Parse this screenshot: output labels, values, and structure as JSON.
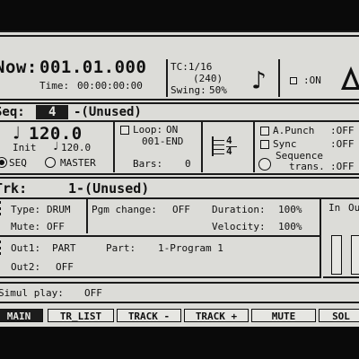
{
  "header": {
    "now_label": "Now:",
    "now_value": "001.01.000",
    "time_label": "Time:",
    "time_value": "00:00:00:00",
    "tc_value": "TC:1/16",
    "tc_paren": "(240)",
    "swing_label": "Swing:",
    "swing_value": "50%",
    "click_label": ":ON"
  },
  "seq": {
    "label": "Seq:",
    "number": "4",
    "name": "-(Unused)",
    "tempo": "120.0",
    "init_label": "Init",
    "init_tempo": "120.0",
    "source_seq": "SEQ",
    "source_master": "MASTER",
    "loop_label": "Loop:",
    "loop_value": "ON",
    "loop_end": "001-END",
    "bars_label": "Bars:",
    "bars_value": "0",
    "time_sig_top": "4",
    "time_sig_bottom": "4",
    "apunch_label": "A.Punch",
    "apunch_value": ":OFF",
    "sync_label": "Sync",
    "sync_value": ":OFF",
    "seqtrans_label1": "Sequence",
    "seqtrans_label2": "trans.",
    "seqtrans_value": ":OFF"
  },
  "track": {
    "label": "Trk:",
    "name": "1-(Unused)",
    "type_label": "Type:",
    "type_value": "DRUM",
    "mute_label": "Mute:",
    "mute_value": "OFF",
    "pgm_label": "Pgm change:",
    "pgm_value": "OFF",
    "duration_label": "Duration:",
    "duration_value": "100%",
    "velocity_label": "Velocity:",
    "velocity_value": "100%",
    "out1_label": "Out1:",
    "out1_value": "PART",
    "part_label": "Part:",
    "part_value": "1-Program 1",
    "out2_label": "Out2:",
    "out2_value": "OFF",
    "in_label": "In",
    "out_label": "Ou"
  },
  "simul": {
    "label": "Simul play:",
    "value": "OFF"
  },
  "softkeys": {
    "main": "MAIN",
    "tr_list": "TR_LIST",
    "track_minus": "TRACK -",
    "track_plus": "TRACK +",
    "mute": "MUTE",
    "solo": "SOL"
  }
}
